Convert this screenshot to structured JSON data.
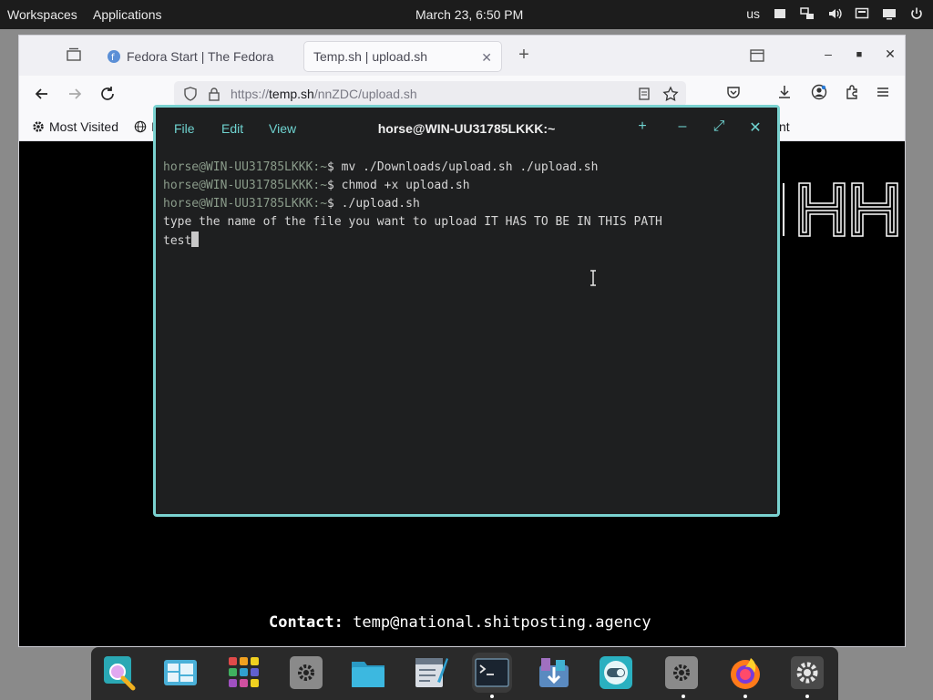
{
  "top_panel": {
    "workspaces": "Workspaces",
    "applications": "Applications",
    "clock": "March 23, 6:50 PM",
    "keyboard_layout": "us"
  },
  "browser": {
    "tabs": [
      {
        "label": "Fedora Start | The Fedora",
        "icon": "fedora-icon",
        "active": false
      },
      {
        "label": "Temp.sh | upload.sh",
        "active": true
      }
    ],
    "url_host": "temp.sh",
    "url_prefix": "https://",
    "url_path": "/nnZDC/upload.sh",
    "bookmarks": [
      {
        "label": "Most Visited",
        "icon": "gear-icon"
      },
      {
        "label": "I",
        "icon": "globe-icon"
      }
    ],
    "bookmark_fragment": "nt",
    "page_contact_label": "Contact:",
    "page_contact_value": "temp@national.shitposting.agency"
  },
  "terminal": {
    "menu": [
      "File",
      "Edit",
      "View"
    ],
    "title": "horse@WIN-UU31785LKKK:~",
    "lines": [
      {
        "user": "horse@WIN-UU31785LKKK",
        "path": ":~",
        "cmd": "$ mv ./Downloads/upload.sh ./upload.sh"
      },
      {
        "user": "horse@WIN-UU31785LKKK",
        "path": ":~",
        "cmd": "$ chmod +x upload.sh"
      },
      {
        "user": "horse@WIN-UU31785LKKK",
        "path": ":~",
        "cmd": "$ ./upload.sh"
      }
    ],
    "output": "type the name of the file you want to upload IT HAS TO BE IN THIS PATH",
    "input": "test"
  },
  "dock": {
    "items": [
      "search-icon",
      "window-switcher-icon",
      "app-grid-icon",
      "settings-app-icon",
      "files-icon",
      "text-editor-icon",
      "terminal-icon",
      "software-center-icon",
      "toggle-app-icon",
      "settings-app-icon",
      "firefox-icon",
      "system-settings-icon"
    ]
  },
  "colors": {
    "terminal_accent": "#7ad2d0",
    "terminal_bg": "#1e1f20",
    "panel_bg": "#1c1c1c"
  }
}
